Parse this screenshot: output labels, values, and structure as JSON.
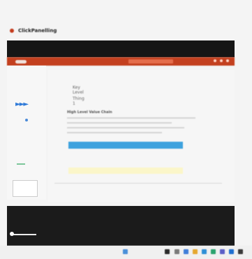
{
  "browser": {
    "top_line_1": "",
    "top_line_2": "",
    "brand": "ClickPanelling",
    "brand_subtitle": ""
  },
  "ribbon": {
    "items": [
      "",
      "",
      "",
      ""
    ],
    "accent": "#c3401f"
  },
  "slide": {
    "key_label_1": "Key Level",
    "key_value_1": "",
    "key_value_2": "",
    "key_label_2": "Thing 1",
    "key_value_3": "",
    "section_title": "High Level Value Chain",
    "table_headers": [
      "",
      "",
      "",
      "",
      "",
      ""
    ],
    "table_rows": [
      [
        "",
        "",
        "",
        "",
        "",
        ""
      ],
      [
        "",
        "",
        "",
        "",
        "",
        ""
      ],
      [
        "",
        "",
        "",
        "",
        "",
        ""
      ],
      [
        "",
        "",
        "",
        "",
        "",
        ""
      ]
    ]
  },
  "taskbar": {
    "weather": ""
  }
}
